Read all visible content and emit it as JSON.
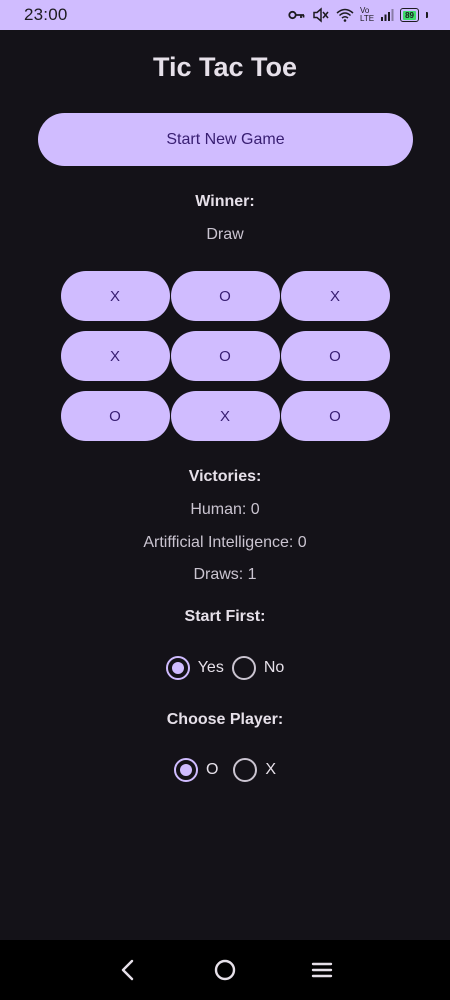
{
  "status_bar": {
    "time": "23:00",
    "battery_level": "89",
    "network_label_1": "Vo",
    "network_label_2": "LTE",
    "icons": [
      "key-icon",
      "mute-icon",
      "wifi-icon",
      "signal-icon",
      "battery-icon"
    ]
  },
  "app": {
    "title": "Tic Tac Toe",
    "start_button_label": "Start New Game",
    "winner_heading": "Winner:",
    "winner_value": "Draw"
  },
  "board": {
    "cells": [
      "X",
      "O",
      "X",
      "X",
      "O",
      "O",
      "O",
      "X",
      "O"
    ]
  },
  "stats": {
    "heading": "Victories:",
    "human": "Human: 0",
    "ai": "Artifficial Intelligence: 0",
    "draws": "Draws: 1"
  },
  "start_first": {
    "heading": "Start First:",
    "options": [
      {
        "label": "Yes",
        "selected": true
      },
      {
        "label": "No",
        "selected": false
      }
    ]
  },
  "choose_player": {
    "heading": "Choose Player:",
    "options": [
      {
        "label": "O",
        "selected": true
      },
      {
        "label": "X",
        "selected": false
      }
    ]
  },
  "colors": {
    "background": "#141218",
    "accent": "#d0bcff",
    "on_accent": "#381e72",
    "status_bar": "#d0bcff",
    "nav_bar": "#000000"
  },
  "nav": {
    "icons": [
      "back-icon",
      "home-icon",
      "menu-icon"
    ]
  }
}
